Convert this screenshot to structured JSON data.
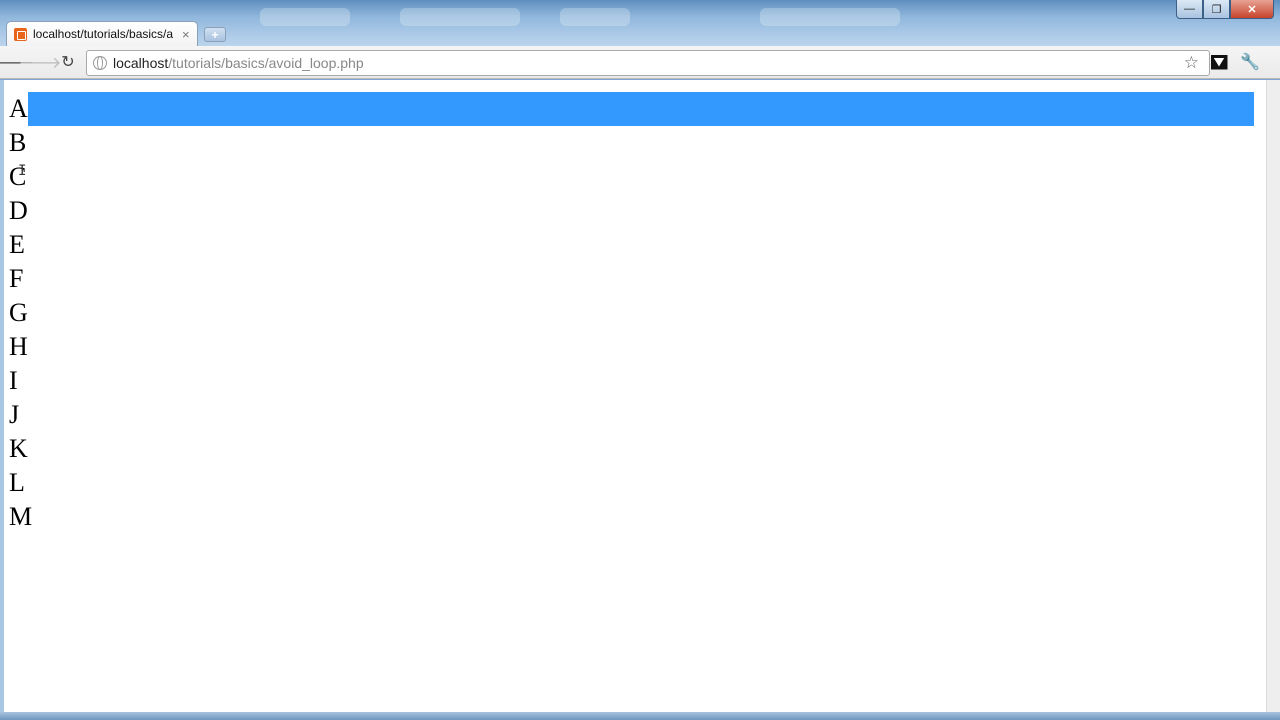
{
  "browser": {
    "tab": {
      "title": "localhost/tutorials/basics/a",
      "close_symbol": "×",
      "favicon": "xampp-favicon-icon"
    },
    "new_tab_symbol": "+",
    "window_controls": {
      "minimize": "—",
      "maximize": "❐",
      "close": "✕"
    },
    "toolbar": {
      "back": "🡐",
      "forward": "🡒",
      "reload": "↻",
      "star": "☆",
      "wrench": "🔧"
    },
    "address_bar": {
      "host": "localhost",
      "path": "/tutorials/basics/avoid_loop.php"
    }
  },
  "page": {
    "letters": [
      "A",
      "B",
      "C",
      "D",
      "E",
      "F",
      "G",
      "H",
      "I",
      "J",
      "K",
      "L",
      "M"
    ],
    "selected_index": 0,
    "selection_color": "#3399ff"
  }
}
